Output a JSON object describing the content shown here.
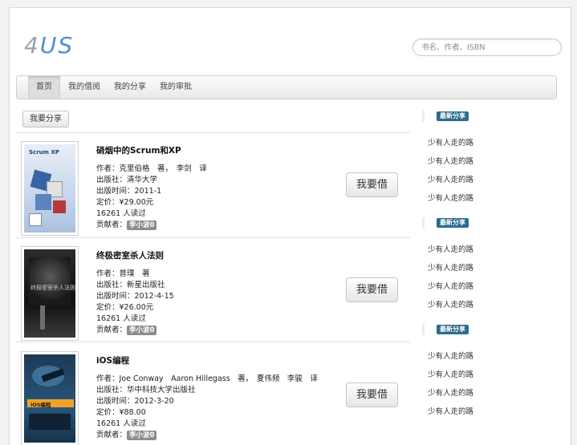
{
  "logo": {
    "num": "4",
    "letters": "US"
  },
  "search": {
    "placeholder": "书名、作者、ISBN"
  },
  "nav": [
    "首页",
    "我的借阅",
    "我的分享",
    "我的审批"
  ],
  "share_button": "我要分享",
  "borrow_label": "我要借",
  "books": [
    {
      "title": "硝烟中的Scrum和XP",
      "author": "作者：克里伯格　著，　李剑　译",
      "publisher": "出版社：清华大学",
      "pubdate": "出版时间：2011-1",
      "price": "定价：¥29.00元",
      "reads": "16261  人读过",
      "contrib_label": "贡献者：",
      "contributor": "李小波0",
      "cover_text": "Scrum XP"
    },
    {
      "title": "终极密室杀人法则",
      "author": "作者：普璞　著",
      "publisher": "出版社：新星出版社",
      "pubdate": "出版时间：2012-4-15",
      "price": "定价：¥26.00元",
      "reads": "16261  人读过",
      "contrib_label": "贡献者：",
      "contributor": "李小波0",
      "cover_text": "终极密室杀人法则"
    },
    {
      "title": "iOS编程",
      "author": "作者：Joe Conway　Aaron Hillegass　著，　夏伟频　李骏　译",
      "publisher": "出版社：华中科技大学出版社",
      "pubdate": "出版时间：2012-3-20",
      "price": "定价：¥88.00",
      "reads": "16261  人读过",
      "contrib_label": "贡献者：",
      "contributor": "李小波0",
      "cover_text": "iOS编程"
    }
  ],
  "sidebar": [
    {
      "heading": "最新分享",
      "links": [
        "少有人走的路",
        "少有人走的路",
        "少有人走的路",
        "少有人走的路"
      ]
    },
    {
      "heading": "最新分享",
      "links": [
        "少有人走的路",
        "少有人走的路",
        "少有人走的路",
        "少有人走的路"
      ]
    },
    {
      "heading": "最新分享",
      "links": [
        "少有人走的路",
        "少有人走的路",
        "少有人走的路",
        "少有人走的路"
      ]
    }
  ]
}
